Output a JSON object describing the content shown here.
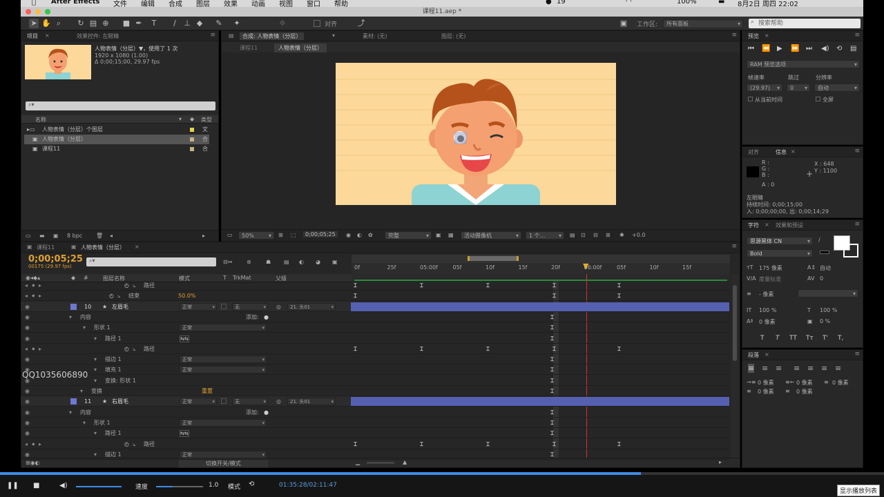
{
  "menubar": {
    "app": "After Effects",
    "items": [
      "文件",
      "编辑",
      "合成",
      "图层",
      "效果",
      "动画",
      "视图",
      "窗口",
      "帮助"
    ],
    "battery": "100%",
    "datetime": "8月2日 周四 22:02",
    "badge": "19"
  },
  "window": {
    "title": "课程11.aep *"
  },
  "toolbar": {
    "snap_label": "对齐",
    "workspace_label": "工作区:",
    "workspace_value": "所有面板",
    "search_placeholder": "搜索帮助"
  },
  "project": {
    "tab_project": "项目",
    "tab_effects": "效果控件: 左眼睛",
    "selected_name": "人物表情（分层）▼，使用了 1 次",
    "selected_res": "1920 x 1080 (1.00)",
    "selected_dur": "Δ 0;00;15;00, 29.97 fps",
    "col_name": "名称",
    "col_type": "类型",
    "items": [
      {
        "name": "人物表情（分层）个图层",
        "type": "文"
      },
      {
        "name": "人物表情（分层）",
        "type": "合"
      },
      {
        "name": "课程11",
        "type": "合"
      }
    ],
    "bpc": "8 bpc"
  },
  "comp": {
    "tab": "合成: 人物表情（分层）",
    "tab_footage": "素材: (无)",
    "tab_layer": "图层: (无)",
    "crumb1": "课程11",
    "crumb2": "人物表情（分层）",
    "zoom": "50%",
    "timecode": "0;00;05;25",
    "quality": "完整",
    "camera": "活动摄像机",
    "views": "1 个...",
    "exposure": "+0.0"
  },
  "timeline": {
    "tab1": "课程11",
    "tab2": "人物表情（分层）",
    "timecode": "0;00;05;25",
    "frames": "00175 (29.97 fps)",
    "col_layername": "图层名称",
    "col_mode": "模式",
    "col_t": "T",
    "col_trkmat": "TrkMat",
    "col_parent": "父级",
    "ruler": [
      "0f",
      "25f",
      "05:00f",
      "05f",
      "10f",
      "15f",
      "20f",
      "06:00f",
      "05f",
      "10f",
      "15f"
    ],
    "rows": [
      {
        "indent": 150,
        "label": "路径",
        "kind": "prop"
      },
      {
        "indent": 128,
        "label": "结束",
        "value": "50.0%",
        "kind": "prop"
      },
      {
        "num": "10",
        "label": "左眉毛",
        "mode": "正常",
        "trk": "无",
        "parent": "21. 头01",
        "kind": "layer"
      },
      {
        "indent": 80,
        "label": "内容",
        "add": "添加:",
        "kind": "group"
      },
      {
        "indent": 100,
        "label": "形状 1",
        "mode": "正常",
        "kind": "group"
      },
      {
        "indent": 116,
        "label": "路径 1",
        "kind": "group"
      },
      {
        "indent": 150,
        "label": "路径",
        "kind": "prop"
      },
      {
        "indent": 116,
        "label": "描边 1",
        "mode": "正常",
        "kind": "group"
      },
      {
        "indent": 116,
        "label": "填充 1",
        "mode": "正常",
        "kind": "group"
      },
      {
        "indent": 116,
        "label": "变换: 形状 1",
        "kind": "group"
      },
      {
        "indent": 96,
        "label": "变换",
        "value": "重置",
        "kind": "group"
      },
      {
        "num": "11",
        "label": "右眉毛",
        "mode": "正常",
        "trk": "无",
        "parent": "21. 头01",
        "kind": "layer"
      },
      {
        "indent": 80,
        "label": "内容",
        "add": "添加:",
        "kind": "group"
      },
      {
        "indent": 100,
        "label": "形状 1",
        "mode": "正常",
        "kind": "group"
      },
      {
        "indent": 116,
        "label": "路径 1",
        "kind": "group"
      },
      {
        "indent": 150,
        "label": "路径",
        "kind": "prop"
      },
      {
        "indent": 116,
        "label": "描边 1",
        "mode": "正常",
        "kind": "group"
      }
    ],
    "toggle_label": "切换开关/模式",
    "watermark": "QQ1035606890"
  },
  "preview": {
    "tab": "预览",
    "ram_label": "RAM 预览选项",
    "fps_label": "帧速率",
    "skip_label": "跳过",
    "res_label": "分辨率",
    "fps_value": "(29.97)",
    "skip_value": "0",
    "res_value": "自动",
    "from_current": "从当前时间",
    "fullscreen": "全屏"
  },
  "info": {
    "tab_align": "对齐",
    "tab_info": "信息",
    "r": "R :",
    "g": "G :",
    "b": "B :",
    "a": "A : 0",
    "x": "X : 648",
    "y": "Y : 1100",
    "layer": "左眼睛",
    "duration": "持续时间: 0;00;15;00",
    "inout": "入: 0;00;00;00, 出: 0;00;14;29"
  },
  "character": {
    "tab": "字符",
    "tab2": "效果和预设",
    "font": "思源黑体 CN",
    "style": "Bold",
    "size": "175 像素",
    "leading": "自动",
    "kerning": "度量标准",
    "tracking": "0",
    "stroke": "- 像素",
    "vscale": "100 %",
    "hscale": "100 %",
    "baseline": "0 像素",
    "tsume": "0 %",
    "styles": [
      "T",
      "T",
      "TT",
      "Tт",
      "T'",
      "T,"
    ]
  },
  "paragraph": {
    "tab": "段落",
    "indent_vals": [
      "0 像素",
      "0 像素",
      "0 像素",
      "0 像素",
      "0 像素"
    ]
  },
  "player": {
    "speed_label": "速度",
    "speed_value": "1.0",
    "mode_label": "模式",
    "time": "01:35:28/02:11:47",
    "playlist": "显示播放列表",
    "progress": 0.725
  }
}
